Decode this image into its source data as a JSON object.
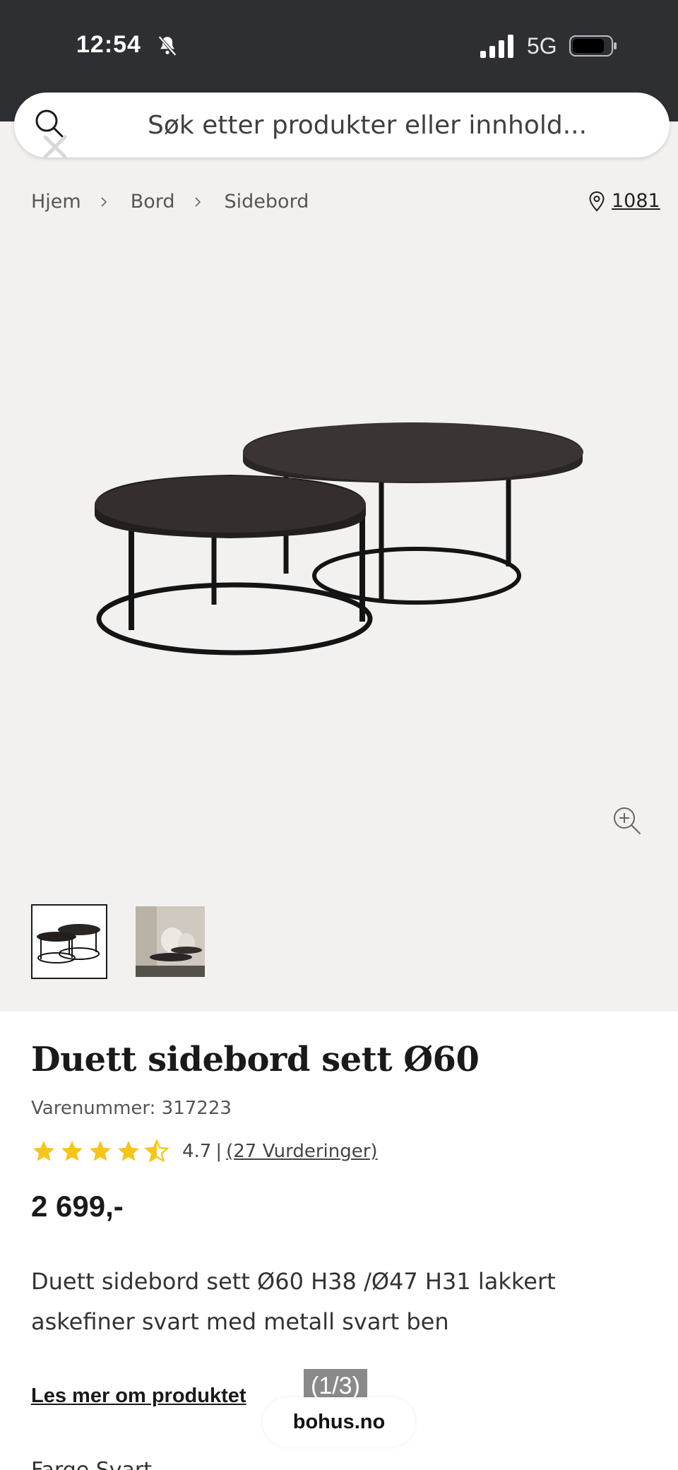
{
  "status_bar": {
    "time": "12:54",
    "network": "5G"
  },
  "search": {
    "placeholder": "Søk etter produkter eller innhold..."
  },
  "breadcrumb": {
    "items": [
      "Hjem",
      "Bord",
      "Sidebord"
    ]
  },
  "store": {
    "code": "1081"
  },
  "product": {
    "title": "Duett sidebord sett Ø60",
    "sku": "Varenummer: 317223",
    "rating": {
      "score": "4.7",
      "separator": "|",
      "reviews_link": "(27 Vurderinger)",
      "stars_value": 4.5,
      "stars_max": 5
    },
    "price": "2 699,-",
    "description": "Duett sidebord sett Ø60 H38 /Ø47 H31 lakkert askefiner svart med metall svart ben",
    "read_more": "Les mer om produktet",
    "cut_off_text": "Farge Svart"
  },
  "overlay": {
    "counter": "(1/3)",
    "url": "bohus.no"
  },
  "colors": {
    "status_bar_bg": "#2e2f33",
    "gallery_bg": "#f3f1ef",
    "star": "#f5c518",
    "text": "#1c1c1c"
  },
  "icons": [
    "bell-slash-icon",
    "signal-icon",
    "battery-icon",
    "search-icon",
    "close-icon",
    "chevron-right-icon",
    "location-pin-icon",
    "zoom-in-icon",
    "star-icon"
  ]
}
